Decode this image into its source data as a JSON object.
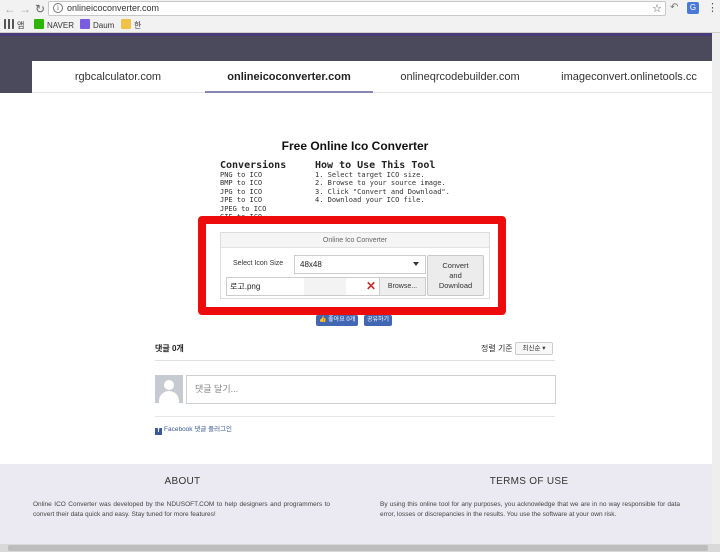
{
  "browser": {
    "url": "onlineicoconverter.com",
    "bookmarks": [
      {
        "label": "앱",
        "color": "#e0533d"
      },
      {
        "label": "NAVER",
        "color": "#2db400"
      },
      {
        "label": "Daum",
        "color": "#7a5ce0"
      },
      {
        "label": "한",
        "color": "#f0c24a"
      }
    ],
    "icons": [
      "back-icon",
      "forward-icon",
      "reload-icon",
      "info-icon",
      "star-icon",
      "menu-icon"
    ]
  },
  "nav": {
    "tabs": [
      {
        "label": "rgbcalculator.com"
      },
      {
        "label": "onlineicoconverter.com"
      },
      {
        "label": "onlineqrcodebuilder.com"
      },
      {
        "label": "imageconvert.onlinetools.cc"
      }
    ],
    "active_index": 1
  },
  "main": {
    "title": "Free Online Ico Converter",
    "conversions_heading": "Conversions",
    "conversions": [
      "PNG to ICO",
      "BMP to ICO",
      "JPG to ICO",
      "JPE to ICO",
      "JPEG to ICO",
      "GIF to ICO"
    ],
    "howto_heading": "How to Use This Tool",
    "howto_steps": [
      "1. Select target ICO size.",
      "2. Browse to your source image.",
      "3. Click \"Convert and Download\".",
      "4. Download your ICO file."
    ]
  },
  "converter": {
    "panel_title": "Online Ico Converter",
    "size_label": "Select Icon Size",
    "size_value": "48x48",
    "file_name": "로고.png",
    "clear_symbol": "✕",
    "browse_label": "Browse...",
    "convert_line1": "Convert",
    "convert_line2": "and",
    "convert_line3": "Download",
    "highlight_color": "#ee0b0b"
  },
  "social": {
    "like_label": "좋아요 0개",
    "share_label": "공유하기"
  },
  "comments": {
    "count_label": "댓글 0개",
    "sort_label": "정렬 기준",
    "sort_value": "최신순 ▾",
    "input_placeholder": "댓글 달기...",
    "plugin_label": "Facebook 댓글 플러그인"
  },
  "footer": {
    "about_title": "ABOUT",
    "about_text": "Online ICO Converter was developed by the NDUSOFT.COM to help designers and programmers to convert their data quick and easy. Stay tuned for more features!",
    "terms_title": "TERMS OF USE",
    "terms_text": "By using this online tool for any purposes, you acknowledge that we are in no way responsible for data error, losses or discrepancies in the results. You use the software at your own risk."
  }
}
